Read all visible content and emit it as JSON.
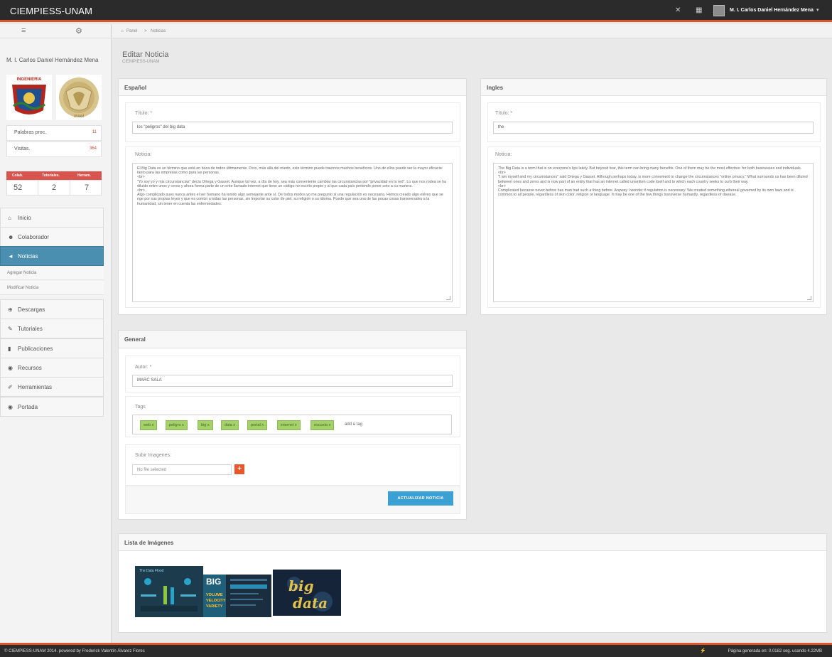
{
  "app": {
    "title": "CIEMPIESS-UNAM"
  },
  "topbar": {
    "user_name": "M. I. Carlos Daniel Hernández Mena",
    "icons": [
      "fullscreen-icon",
      "grid-icon",
      "user-avatar",
      "caret-down-icon"
    ]
  },
  "sidebar": {
    "user_name": "M. I. Carlos Daniel Hernández Mena",
    "logos": [
      "INGENIERIA",
      "UNAM"
    ],
    "stats": [
      {
        "label": "Palabras proc.",
        "value": "11"
      },
      {
        "label": "Visitas.",
        "value": "364"
      }
    ],
    "counts": {
      "headers": [
        "Colab.",
        "Tutoriales.",
        "Herram."
      ],
      "values": [
        "52",
        "2",
        "7"
      ]
    },
    "menu": [
      {
        "label": "Inicio",
        "icon": "home-icon",
        "glyph": "⌂"
      },
      {
        "label": "Colaborador",
        "icon": "users-icon",
        "glyph": "☻"
      },
      {
        "label": "Noticias",
        "icon": "bullhorn-icon",
        "glyph": "◄",
        "active": true
      },
      {
        "label": "Descargas",
        "icon": "download-icon",
        "glyph": "⊕"
      },
      {
        "label": "Tutoriales",
        "icon": "pencil-icon",
        "glyph": "✎"
      },
      {
        "label": "Publicaciones",
        "icon": "book-icon",
        "glyph": "▮"
      },
      {
        "label": "Recursos",
        "icon": "globe-icon",
        "glyph": "◉"
      },
      {
        "label": "Herramientas",
        "icon": "wrench-icon",
        "glyph": "✐"
      },
      {
        "label": "Portada",
        "icon": "eye-icon",
        "glyph": "◉"
      }
    ],
    "submenu": [
      "Agregar Noticia",
      "Modificar Noticia"
    ]
  },
  "breadcrumb": {
    "home": "Panel",
    "separator": ">",
    "current": "Noticias"
  },
  "page": {
    "title": "Editar Noticia",
    "subtitle": "CIEMPIESS-UNAM"
  },
  "espanol": {
    "heading": "Español",
    "titulo_label": "Título: *",
    "titulo_value": "los \"peligros\" del big data",
    "noticia_label": "Noticia:",
    "noticia_lines": [
      "El Big Data es un término que está en boca de todos últimamente. Pero, más allá del miedo, este término puede traernos muchos beneficios. Uno de ellos puede ser la mayor eficacia: tanto para las empresas como para las personas.",
      "<br>",
      "\"Yo soy yo y mis circunstancias\" decía Ortega y Gasset. Aunque tal vez, a día de hoy, sea más conveniente cambiar las circunstancias por \"privacidad en la red\". Lo que nos rodea se ha diluido entre unos y ceros y ahora forma parte de un ente llamado internet que tiene un código no escrito propio y al que cada país pretende poner coto a su manera.",
      "<br>",
      "Algo complicado pues nunca antes el ser humano ha tenido algo semejante ante sí. De todos modos yo me pregunto si una regulación es necesaria. Hemos creado algo etéreo que se rige por sus propias leyes y que es común a todas las personas, sin importar su color de piel, su religión o su idioma. Puede que sea una de las pocas cosas transversales a la humanidad, sin tener en cuenta las enfermedades."
    ]
  },
  "ingles": {
    "heading": "Ingles",
    "titulo_label": "Título: *",
    "titulo_value": "the",
    "noticia_label": "Noticia:",
    "noticia_lines": [
      "The Big Data is a term that is on everyone's lips lately. But beyond fear, this term can bring many benefits. One of them may be the most effective: for both businesses and individuals.",
      "<br>",
      "\"I am myself and my circumstances\" said Ortega y Gasset. Although perhaps today, is more convenient to change the circumstances \"online privacy.\" What surrounds us has been diluted between ones and zeros and is now part of an entity that has an internet called unwritten code itself and to which each country seeks to curb their way.",
      "<br>",
      "Complicated because never before has man had such a thing before. Anyway I wonder if regulation is necessary. We created something ethereal governed by its own laws and is common to all people, regardless of skin color, religion or language. It may be one of the few things transverse humanity, regardless of disease."
    ]
  },
  "general": {
    "heading": "General",
    "autor_label": "Autor: *",
    "autor_value": "MARC SALA",
    "tags_label": "Tags",
    "tags": [
      "web",
      "peligro",
      "big",
      "data",
      "portal",
      "internet",
      "escuela"
    ],
    "tag_remove": "x",
    "tag_add_placeholder": "add a tag",
    "subir_label": "Subir Imagenes:",
    "file_placeholder": "No file selected",
    "file_button": "+",
    "submit": "ACTUALIZAR NOTICIA"
  },
  "imagenes": {
    "heading": "Lista de Imágenes",
    "thumbs": [
      {
        "name": "infographic-thumb",
        "texts": [
          "The Data Flood"
        ]
      },
      {
        "name": "big-data-thumb",
        "texts": [
          "BIG",
          "VOLUME",
          "VELOCITY",
          "VARIETY"
        ]
      },
      {
        "name": "big-data-glow-thumb",
        "texts": [
          "big",
          "data"
        ]
      }
    ]
  },
  "footer": {
    "left": "© CIEMPIESS-UNAM 2014. powered by Frederick Valentín Álvarez Flores",
    "right": "Página generada en: 0.0182 seg. usando 4.22MB"
  },
  "colors": {
    "topbar": "#2b2b2b",
    "accent": "#d9572b",
    "active_menu": "#4a8fb0",
    "tag_bg": "#a5d16b",
    "submit": "#3ba0d4"
  }
}
